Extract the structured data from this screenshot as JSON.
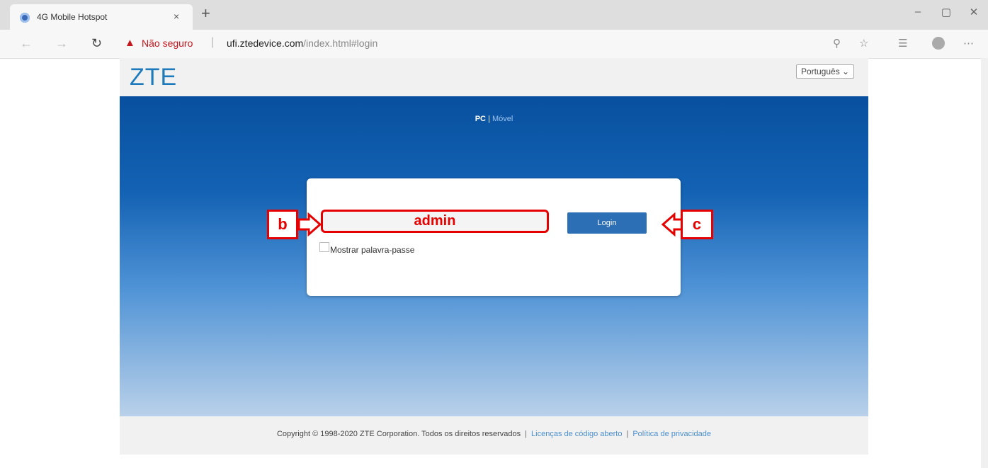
{
  "browser": {
    "tab_title": "4G Mobile Hotspot",
    "tab_close": "×",
    "new_tab": "+",
    "minimize": "–",
    "restore": "▢",
    "close": "✕",
    "back": "←",
    "forward": "→",
    "refresh": "↻",
    "not_secure": "Não seguro",
    "url_host": "ufi.ztedevice.com",
    "url_path": "/index.html#login"
  },
  "header": {
    "logo": "ZTE",
    "language": "Português ⌄"
  },
  "hero": {
    "mode_pc": "PC",
    "mode_sep": " | ",
    "mode_mobile": "Móvel"
  },
  "login": {
    "password_value": "admin",
    "button": "Login",
    "show_password": "Mostrar palavra-passe"
  },
  "annotations": {
    "b": "b",
    "c": "c"
  },
  "footer": {
    "copyright": "Copyright © 1998-2020 ZTE Corporation. Todos os direitos reservados",
    "sep": "|",
    "open_source": "Licenças de código aberto",
    "privacy": "Política de privacidade"
  },
  "colors": {
    "accent": "#e60000",
    "brand": "#1d7bbd",
    "button": "#2c6fb5"
  }
}
